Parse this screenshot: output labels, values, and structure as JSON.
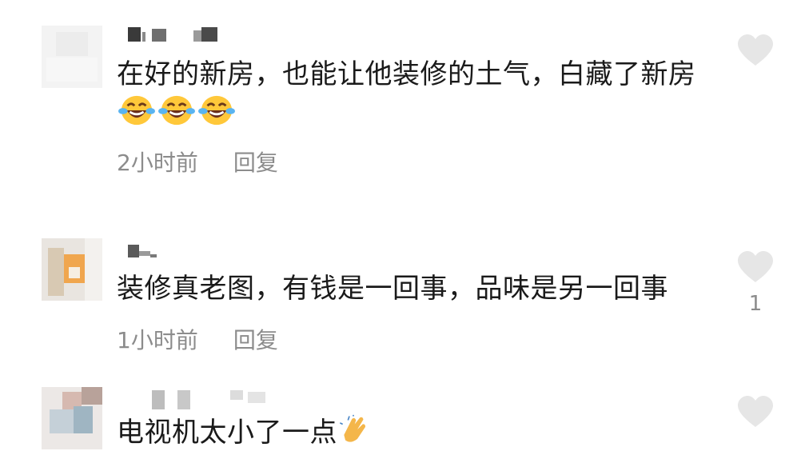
{
  "comments": [
    {
      "text": "在好的新房，也能让他装修的土气，白藏了新房",
      "emoji": "laughing-crying-emoji",
      "emoji_count": 3,
      "time": "2小时前",
      "reply_label": "回复",
      "likes": ""
    },
    {
      "text": "装修真老图，有钱是一回事，品味是另一回事",
      "time": "1小时前",
      "reply_label": "回复",
      "likes": "1"
    },
    {
      "text": "电视机太小了一点",
      "emoji": "clapping-hands-emoji"
    }
  ],
  "colors": {
    "text": "#1a1a1a",
    "meta": "#8c8c8c",
    "heart": "#e6e6e6"
  }
}
